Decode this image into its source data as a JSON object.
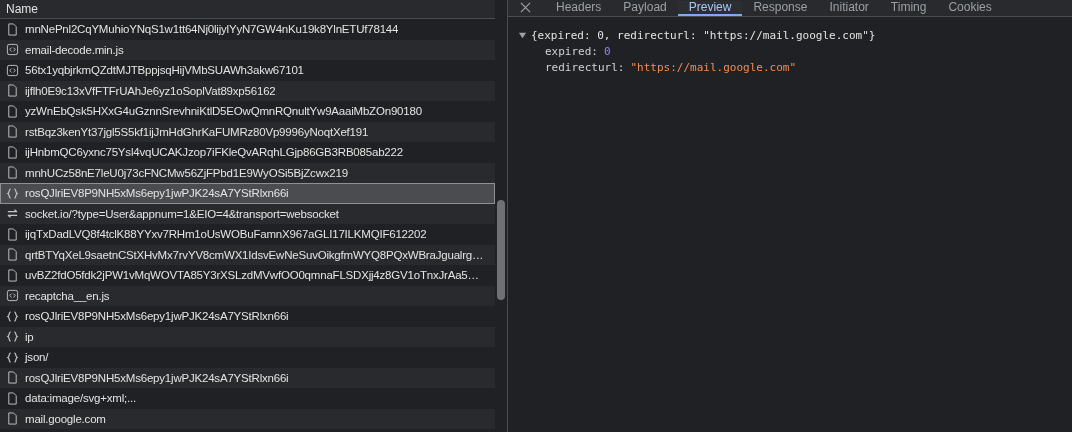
{
  "requests": {
    "header": "Name",
    "rows": [
      {
        "kind": "document",
        "name": "mnNePnl2CqYMuhioYNqS1w1tt64Nj0lijylYyN7GW4nKu19k8YlnETUf78144",
        "selected": false
      },
      {
        "kind": "script",
        "name": "email-decode.min.js",
        "selected": false
      },
      {
        "kind": "script",
        "name": "56tx1yqbjrkmQZdtMJTBppjsqHijVMbSUAWh3akw67101",
        "selected": false
      },
      {
        "kind": "document",
        "name": "ijflh0E9c13xVfFTFrUAhJe6yz1oSoplVat89xp56162",
        "selected": false
      },
      {
        "kind": "document",
        "name": "yzWnEbQsk5HXxG4uGznnSrevhniKtlD5EOwQmnRQnultYw9AaaiMbZOn90180",
        "selected": false
      },
      {
        "kind": "document",
        "name": "rstBqz3kenYt37jgl5S5kf1ijJmHdGhrKaFUMRz80Vp9996yNoqtXef191",
        "selected": false
      },
      {
        "kind": "document",
        "name": "ijHnbmQC6yxnc75Ysl4vqUCAKJzop7iFKleQvARqhLGjp86GB3RB085ab222",
        "selected": false
      },
      {
        "kind": "document",
        "name": "mnhUCz58nE7leU0j73cFNCMw56ZjFPbd1E9WyOSi5BjZcwx219",
        "selected": false
      },
      {
        "kind": "fetch",
        "name": "rosQJlriEV8P9NH5xMs6epy1jwPJK24sA7YStRlxn66i",
        "selected": true
      },
      {
        "kind": "websocket",
        "name": "socket.io/?type=User&appnum=1&EIO=4&transport=websocket",
        "selected": false
      },
      {
        "kind": "document",
        "name": "ijqTxDadLVQ8f4tclK88YYxv7RHm1oUsWOBuFamnX967aGLI17ILKMQIF612202",
        "selected": false
      },
      {
        "kind": "document",
        "name": "qrtBTYqXeL9saetnCStXHvMx7rvYV8cmWX1IdsvEwNeSuvOikgfmWYQ8PQxWBraJgualrg…",
        "selected": false
      },
      {
        "kind": "document",
        "name": "uvBZ2fdO5fdk2jPW1vMqWOVTA85Y3rXSLzdMVwfOO0qmnaFLSDXjj4z8GV1oTnxJrAa5…",
        "selected": false
      },
      {
        "kind": "script",
        "name": "recaptcha__en.js",
        "selected": false
      },
      {
        "kind": "fetch",
        "name": "rosQJlriEV8P9NH5xMs6epy1jwPJK24sA7YStRlxn66i",
        "selected": false
      },
      {
        "kind": "fetch",
        "name": "ip",
        "selected": false
      },
      {
        "kind": "fetch",
        "name": "json/",
        "selected": false
      },
      {
        "kind": "document",
        "name": "rosQJlriEV8P9NH5xMs6epy1jwPJK24sA7YStRlxn66i",
        "selected": false
      },
      {
        "kind": "document",
        "name": "data:image/svg+xml;...",
        "selected": false
      },
      {
        "kind": "document",
        "name": "mail.google.com",
        "selected": false
      }
    ]
  },
  "details": {
    "tabs": [
      {
        "label": "Headers",
        "selected": false
      },
      {
        "label": "Payload",
        "selected": false
      },
      {
        "label": "Preview",
        "selected": true
      },
      {
        "label": "Response",
        "selected": false
      },
      {
        "label": "Initiator",
        "selected": false
      },
      {
        "label": "Timing",
        "selected": false
      },
      {
        "label": "Cookies",
        "selected": false
      }
    ],
    "preview": {
      "expanded": true,
      "summary": "{expired: 0, redirecturl: \"https://mail.google.com\"}",
      "properties": [
        {
          "kind": "number",
          "key": "expired:",
          "value": "0"
        },
        {
          "kind": "string",
          "key": "redirecturl:",
          "value": "\"https://mail.google.com\""
        }
      ]
    }
  }
}
